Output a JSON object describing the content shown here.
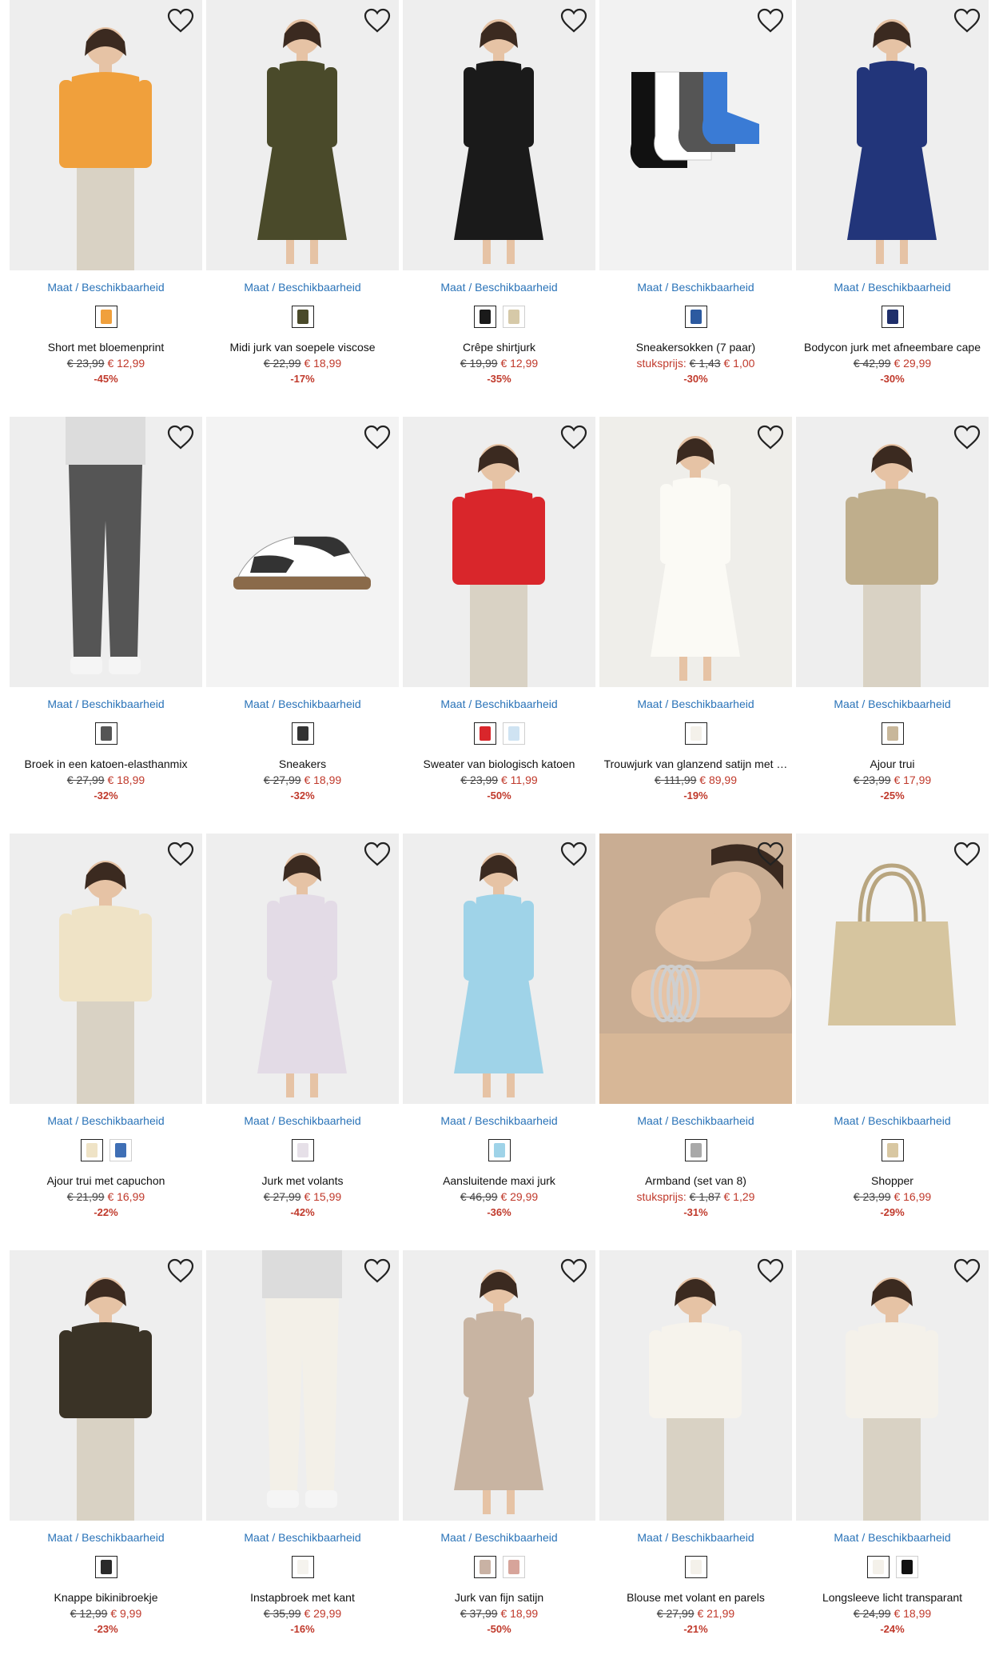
{
  "size_link_label_a": "Maat",
  "size_link_sep": "/",
  "size_link_label_b": "Beschikbaarheid",
  "products": [
    {
      "name": "Short met bloemenprint",
      "unit_label": "",
      "old_price": "€ 23,99",
      "new_price": "€ 12,99",
      "discount": "-45%",
      "swatches": [
        "#f0a03c"
      ],
      "bg": "#eeeeee",
      "fig": "#f0a03c",
      "art": "person"
    },
    {
      "name": "Midi jurk van soepele viscose",
      "unit_label": "",
      "old_price": "€ 22,99",
      "new_price": "€ 18,99",
      "discount": "-17%",
      "swatches": [
        "#4a4a2a"
      ],
      "bg": "#eeeeee",
      "fig": "#4a4a2a",
      "art": "dress"
    },
    {
      "name": "Crêpe shirtjurk",
      "unit_label": "",
      "old_price": "€ 19,99",
      "new_price": "€ 12,99",
      "discount": "-35%",
      "swatches": [
        "#1a1a1a",
        "#d6c9a8"
      ],
      "bg": "#eeeeee",
      "fig": "#1a1a1a",
      "art": "dress"
    },
    {
      "name": "Sneakersokken (7 paar)",
      "unit_label": "stuksprijs:",
      "old_price": "€ 1,43",
      "new_price": "€ 1,00",
      "discount": "-30%",
      "swatches": [
        "#2c5aa0"
      ],
      "bg": "#f2f2f2",
      "fig": "#3a7bd5",
      "art": "socks"
    },
    {
      "name": "Bodycon jurk met afneembare cape",
      "unit_label": "",
      "old_price": "€ 42,99",
      "new_price": "€ 29,99",
      "discount": "-30%",
      "swatches": [
        "#1f2f6b"
      ],
      "bg": "#eeeeee",
      "fig": "#22357a",
      "art": "dress"
    },
    {
      "name": "Broek in een katoen-elasthanmix",
      "unit_label": "",
      "old_price": "€ 27,99",
      "new_price": "€ 18,99",
      "discount": "-32%",
      "swatches": [
        "#555555"
      ],
      "bg": "#eeeeee",
      "fig": "#555555",
      "art": "pants"
    },
    {
      "name": "Sneakers",
      "unit_label": "",
      "old_price": "€ 27,99",
      "new_price": "€ 18,99",
      "discount": "-32%",
      "swatches": [
        "#333333"
      ],
      "bg": "#f3f3f3",
      "fig": "#333333",
      "art": "shoe"
    },
    {
      "name": "Sweater van biologisch katoen",
      "unit_label": "",
      "old_price": "€ 23,99",
      "new_price": "€ 11,99",
      "discount": "-50%",
      "swatches": [
        "#d9262b",
        "#cfe3f2"
      ],
      "bg": "#eeeeee",
      "fig": "#d9262b",
      "art": "person"
    },
    {
      "name": "Trouwjurk van glanzend satijn met …",
      "unit_label": "",
      "old_price": "€ 111,99",
      "new_price": "€ 89,99",
      "discount": "-19%",
      "swatches": [
        "#f4f1ea"
      ],
      "bg": "#efeeea",
      "fig": "#fbfaf5",
      "art": "dress"
    },
    {
      "name": "Ajour trui",
      "unit_label": "",
      "old_price": "€ 23,99",
      "new_price": "€ 17,99",
      "discount": "-25%",
      "swatches": [
        "#c8b79a"
      ],
      "bg": "#eeeeee",
      "fig": "#bfae8c",
      "art": "person"
    },
    {
      "name": "Ajour trui met capuchon",
      "unit_label": "",
      "old_price": "€ 21,99",
      "new_price": "€ 16,99",
      "discount": "-22%",
      "swatches": [
        "#efe3c6",
        "#3f6fb5"
      ],
      "bg": "#eeeeee",
      "fig": "#efe3c6",
      "art": "person"
    },
    {
      "name": "Jurk met volants",
      "unit_label": "",
      "old_price": "€ 27,99",
      "new_price": "€ 15,99",
      "discount": "-42%",
      "swatches": [
        "#e6e0e8"
      ],
      "bg": "#eeeeee",
      "fig": "#e3dbe6",
      "art": "dress"
    },
    {
      "name": "Aansluitende maxi jurk",
      "unit_label": "",
      "old_price": "€ 46,99",
      "new_price": "€ 29,99",
      "discount": "-36%",
      "swatches": [
        "#9fd3e8"
      ],
      "bg": "#eeeeee",
      "fig": "#9fd3e8",
      "art": "dress"
    },
    {
      "name": "Armband (set van 8)",
      "unit_label": "stuksprijs:",
      "old_price": "€ 1,87",
      "new_price": "€ 1,29",
      "discount": "-31%",
      "swatches": [
        "#a9a9a9"
      ],
      "bg": "#c9ad93",
      "fig": "#8a6a52",
      "art": "bracelet"
    },
    {
      "name": "Shopper",
      "unit_label": "",
      "old_price": "€ 23,99",
      "new_price": "€ 16,99",
      "discount": "-29%",
      "swatches": [
        "#d8c7a2"
      ],
      "bg": "#f3f3f3",
      "fig": "#d6c59f",
      "art": "bag"
    },
    {
      "name": "Knappe bikinibroekje",
      "unit_label": "",
      "old_price": "€ 12,99",
      "new_price": "€ 9,99",
      "discount": "-23%",
      "swatches": [
        "#2a2a2a"
      ],
      "bg": "#eeeeee",
      "fig": "#3a3326",
      "art": "person"
    },
    {
      "name": "Instapbroek met kant",
      "unit_label": "",
      "old_price": "€ 35,99",
      "new_price": "€ 29,99",
      "discount": "-16%",
      "swatches": [
        "#f5f3ee"
      ],
      "bg": "#eeeeee",
      "fig": "#f3f0e8",
      "art": "pants"
    },
    {
      "name": "Jurk van fijn satijn",
      "unit_label": "",
      "old_price": "€ 37,99",
      "new_price": "€ 18,99",
      "discount": "-50%",
      "swatches": [
        "#c9b2a4",
        "#d7a49a"
      ],
      "bg": "#eeeeee",
      "fig": "#c8b4a2",
      "art": "dress"
    },
    {
      "name": "Blouse met volant en parels",
      "unit_label": "",
      "old_price": "€ 27,99",
      "new_price": "€ 21,99",
      "discount": "-21%",
      "swatches": [
        "#f4f1ea"
      ],
      "bg": "#eeeeee",
      "fig": "#f6f3ec",
      "art": "person"
    },
    {
      "name": "Longsleeve licht transparant",
      "unit_label": "",
      "old_price": "€ 24,99",
      "new_price": "€ 18,99",
      "discount": "-24%",
      "swatches": [
        "#f4f1ea",
        "#111111"
      ],
      "bg": "#eeeeee",
      "fig": "#f4f1ea",
      "art": "person"
    }
  ],
  "icons": {
    "wishlist": "heart-outline-icon"
  },
  "colors": {
    "link": "#2a73b8",
    "sale": "#c0392b"
  }
}
